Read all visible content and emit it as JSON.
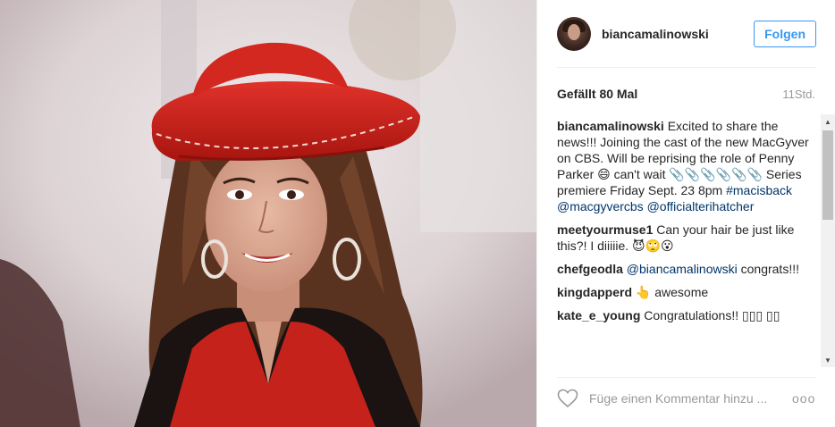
{
  "post": {
    "username": "biancamalinowski",
    "follow_label": "Folgen",
    "likes": "Gefällt 80 Mal",
    "time": "11Std."
  },
  "comments": [
    {
      "user": "biancamalinowski",
      "text": " Excited to share the news!!! Joining the cast of the new MacGyver on CBS. Will be reprising the role of Penny Parker 😄 can't wait 📎📎📎📎📎📎 Series premiere Friday Sept. 23 8pm ",
      "tags": [
        "#macisback",
        "@macgyvercbs",
        "@officialterihatcher"
      ]
    },
    {
      "user": "meetyourmuse1",
      "text": " Can your hair be just like this?! I diiiiie. 😈🙄😮",
      "tags": []
    },
    {
      "user": "chefgeodla",
      "text": " congrats!!!",
      "tags": [
        "@biancamalinowski"
      ]
    },
    {
      "user": "kingdapperd",
      "text": " 👆 awesome",
      "tags": []
    },
    {
      "user": "kate_e_young",
      "text": " Congratulations!! ▯▯▯ ▯▯",
      "tags": []
    }
  ],
  "footer": {
    "comment_placeholder": "Füge einen Kommentar hinzu ...",
    "more_label": "ooo"
  },
  "icons": {
    "like": "heart-icon",
    "more": "more-options-icon",
    "scroll_up": "scroll-up-arrow-icon",
    "scroll_down": "scroll-down-arrow-icon"
  },
  "colors": {
    "accent": "#3897f0",
    "hashtag": "#003569",
    "muted": "#999999",
    "hat": "#c8221e"
  }
}
